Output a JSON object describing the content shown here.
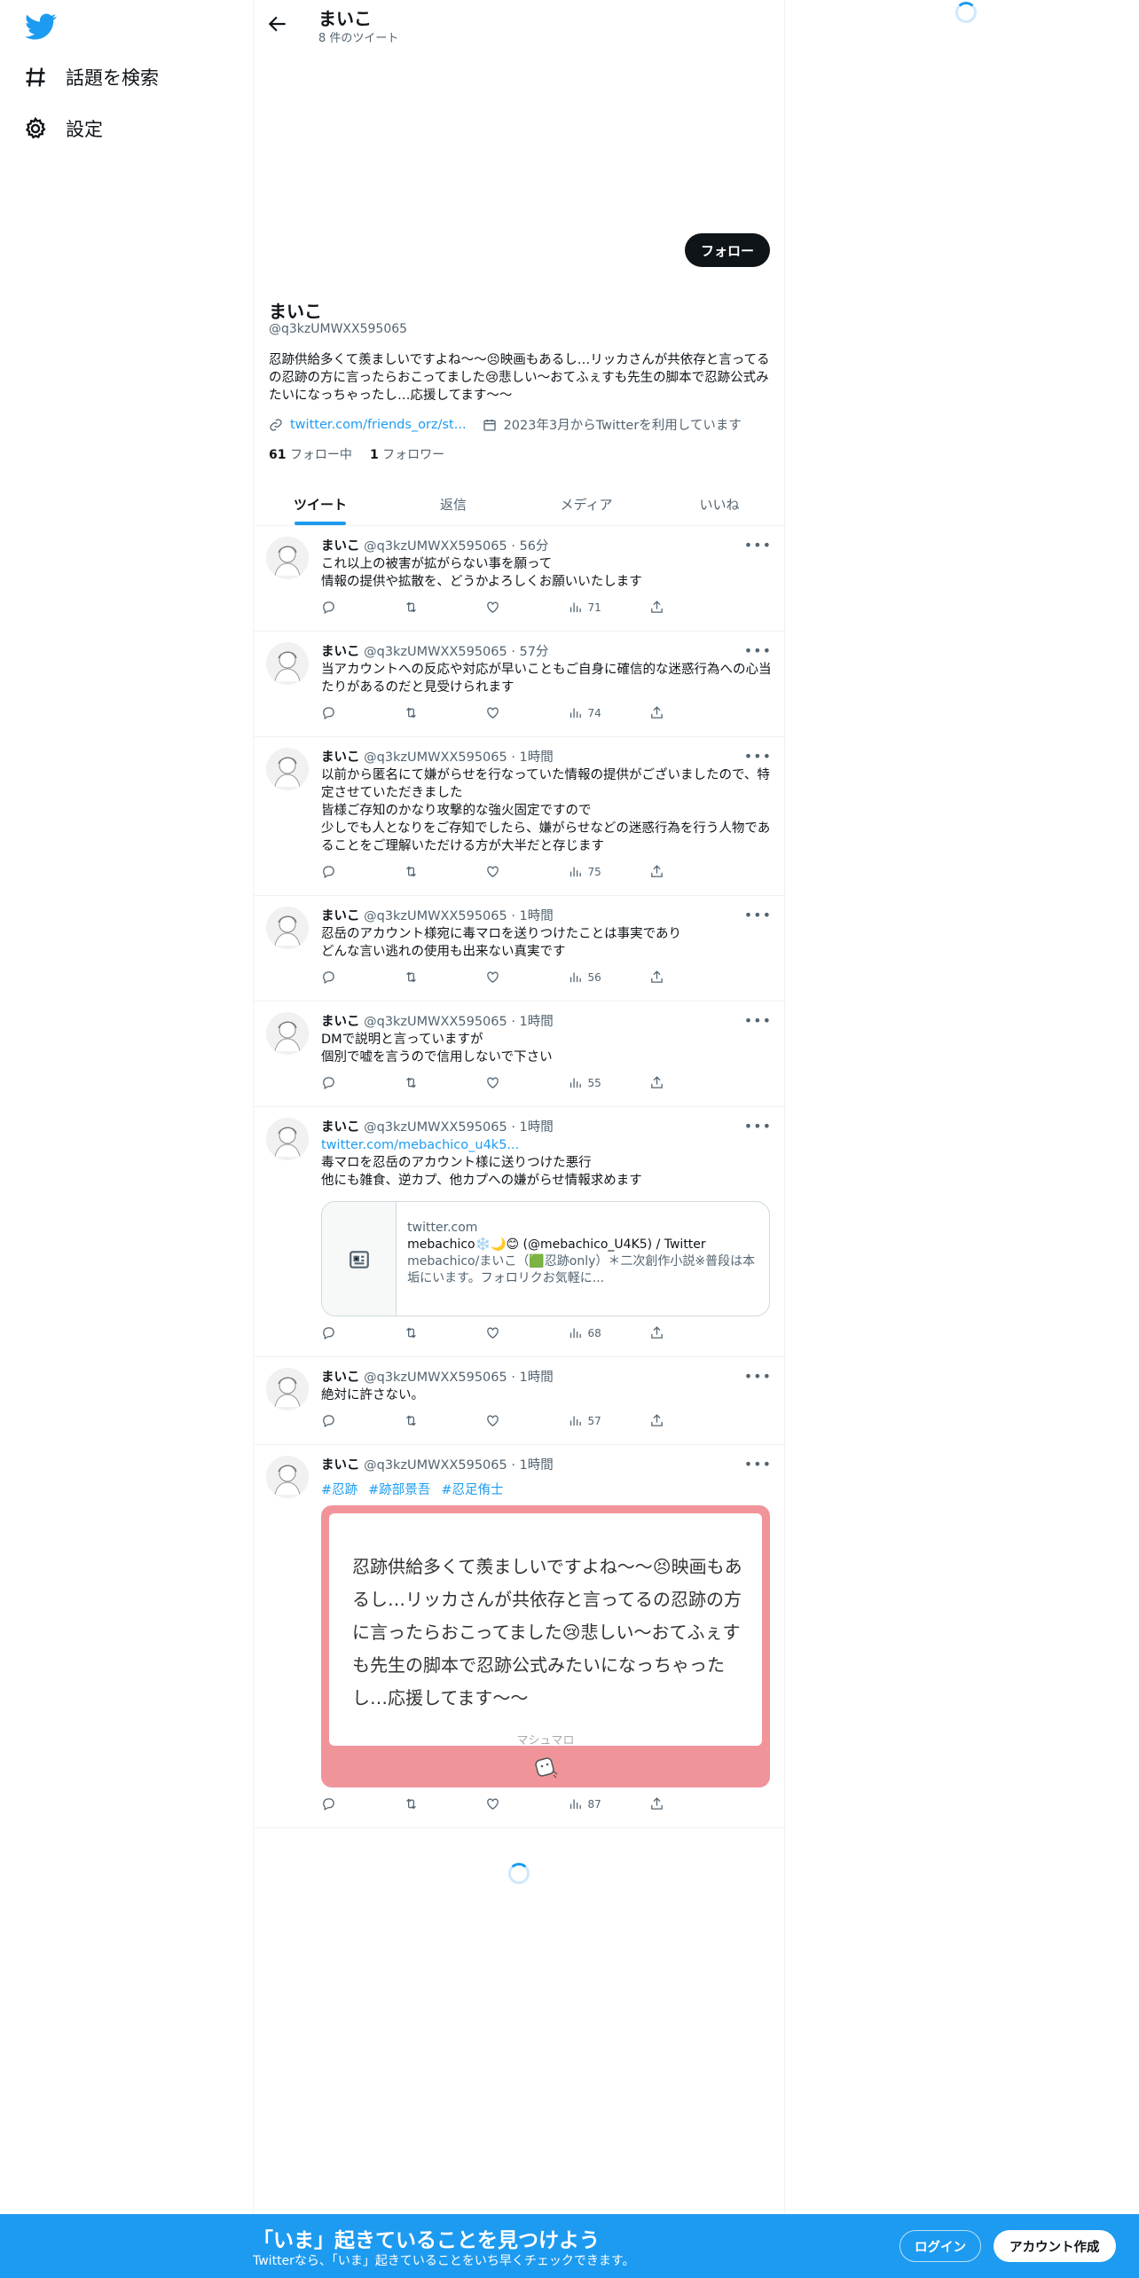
{
  "sidebar": {
    "logo": "twitter-bird-icon",
    "items": [
      {
        "icon": "hashtag-icon",
        "label": "話題を検索"
      },
      {
        "icon": "gear-icon",
        "label": "設定"
      }
    ]
  },
  "header": {
    "name": "まいこ",
    "tweet_count": "8 件のツイート"
  },
  "profile": {
    "follow_label": "フォロー",
    "name": "まいこ",
    "handle": "@q3kzUMWXX595065",
    "bio": "忍跡供給多くて羨ましいですよね〜〜😣映画もあるし…リッカさんが共依存と言ってるの忍跡の方に言ったらおこってました😢悲しい〜おてふぇすも先生の脚本で忍跡公式みたいになっちゃったし…応援してます〜〜",
    "link": "twitter.com/friends_orz/st...",
    "joined": "2023年3月からTwitterを利用しています",
    "following_count": "61",
    "following_label": "フォロー中",
    "followers_count": "1",
    "followers_label": "フォロワー"
  },
  "tabs": [
    "ツイート",
    "返信",
    "メディア",
    "いいね"
  ],
  "tweets": [
    {
      "name": "まいこ",
      "meta": "@q3kzUMWXX595065 · 56分",
      "text": "これ以上の被害が拡がらない事を願って\n情報の提供や拡散を、どうかよろしくお願いいたします",
      "views": "71"
    },
    {
      "name": "まいこ",
      "meta": "@q3kzUMWXX595065 · 57分",
      "text": "当アカウントへの反応や対応が早いこともご自身に確信的な迷惑行為への心当たりがあるのだと見受けられます",
      "views": "74"
    },
    {
      "name": "まいこ",
      "meta": "@q3kzUMWXX595065 · 1時間",
      "text": "以前から匿名にて嫌がらせを行なっていた情報の提供がございましたので、特定させていただきました\n皆様ご存知のかなり攻撃的な強火固定ですので\n少しでも人となりをご存知でしたら、嫌がらせなどの迷惑行為を行う人物であることをご理解いただける方が大半だと存じます",
      "views": "75"
    },
    {
      "name": "まいこ",
      "meta": "@q3kzUMWXX595065 · 1時間",
      "text": "忍岳のアカウント様宛に毒マロを送りつけたことは事実であり\nどんな言い逃れの使用も出来ない真実です",
      "views": "56"
    },
    {
      "name": "まいこ",
      "meta": "@q3kzUMWXX595065 · 1時間",
      "text": "DMで説明と言っていますが\n個別で嘘を言うので信用しないで下さい",
      "views": "55"
    },
    {
      "name": "まいこ",
      "meta": "@q3kzUMWXX595065 · 1時間",
      "link": "twitter.com/mebachico_u4k5...",
      "text": "毒マロを忍岳のアカウント様に送りつけた悪行\n他にも雑食、逆カプ、他カプへの嫌がらせ情報求めます",
      "card": {
        "domain": "twitter.com",
        "title": "mebachico❄️🌙😊 (@mebachico_U4K5) / Twitter",
        "desc": "mebachico/まいこ（🟩忍跡only）＊二次創作小説※普段は本垢にいます。フォロリクお気軽に..."
      },
      "views": "68"
    },
    {
      "name": "まいこ",
      "meta": "@q3kzUMWXX595065 · 1時間",
      "text": "絶対に許さない。",
      "views": "57"
    },
    {
      "name": "まいこ",
      "meta": "@q3kzUMWXX595065 · 1時間",
      "hashtags": [
        "#忍跡",
        "#跡部景吾",
        "#忍足侑士"
      ],
      "marshmallow": {
        "text": "忍跡供給多くて羨ましいですよね〜〜😣映画もあるし…リッカさんが共依存と言ってるの忍跡の方に言ったらおこってました😢悲しい〜おてふぇすも先生の脚本で忍跡公式みたいになっちゃったし…応援してます〜〜",
        "brand": "マシュマロ"
      },
      "views": "87"
    }
  ],
  "bottom_bar": {
    "title": "「いま」起きていることを見つけよう",
    "subtitle": "Twitterなら、「いま」起きていることをいち早くチェックできます。",
    "login": "ログイン",
    "signup": "アカウント作成"
  },
  "colors": {
    "accent": "#1d9bf0",
    "text": "#0f1419",
    "muted": "#536471",
    "marshmallow": "#f0949a"
  }
}
